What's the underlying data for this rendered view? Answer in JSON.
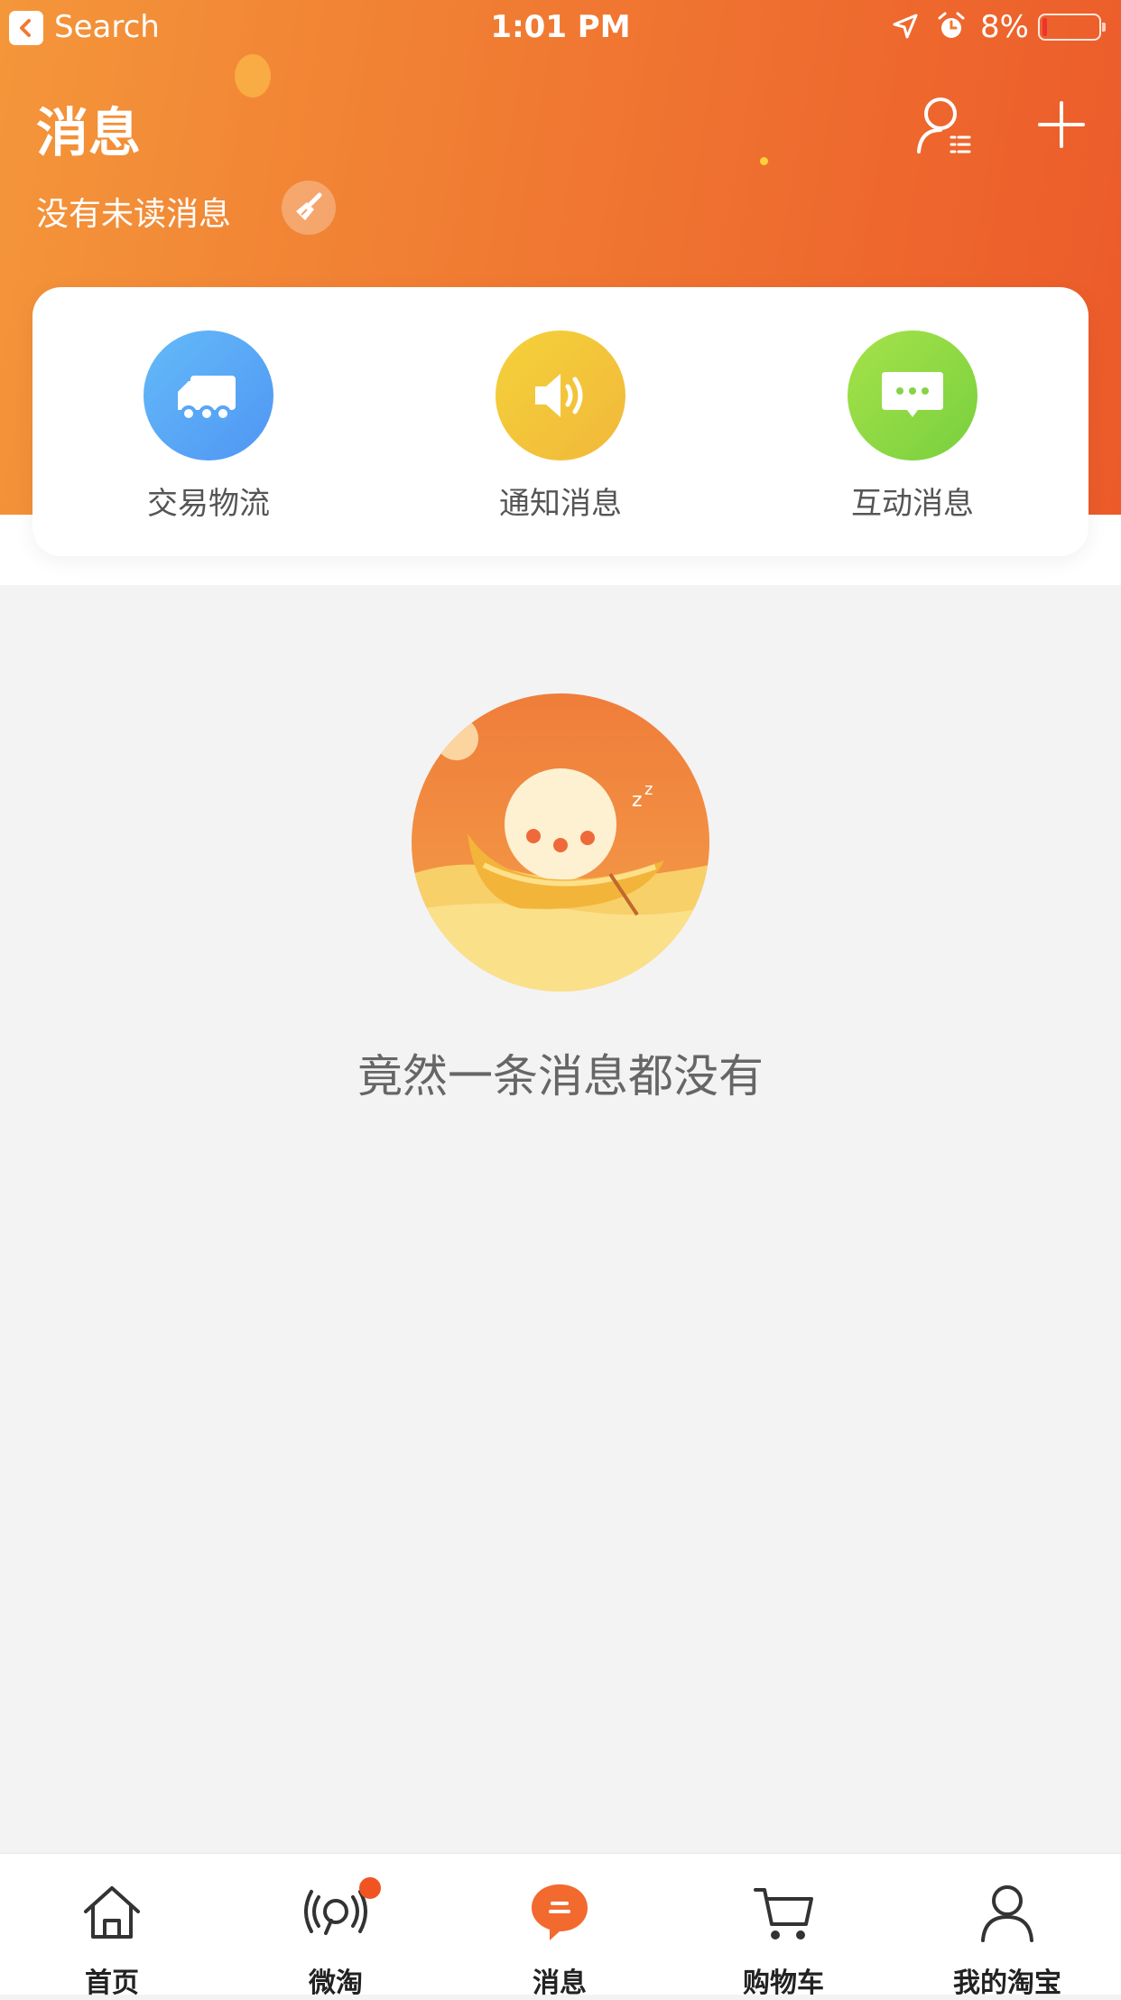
{
  "status_bar": {
    "back_label": "Search",
    "time": "1:01 PM",
    "battery": "8%"
  },
  "header": {
    "title": "消息",
    "subtitle": "没有未读消息"
  },
  "categories": [
    {
      "label": "交易物流",
      "icon": "truck-icon",
      "color": "#5aa8f8"
    },
    {
      "label": "通知消息",
      "icon": "speaker-icon",
      "color": "#f2c537"
    },
    {
      "label": "互动消息",
      "icon": "chat-dots-icon",
      "color": "#8ed84a"
    }
  ],
  "empty_state": {
    "message": "竟然一条消息都没有"
  },
  "tab_bar": {
    "items": [
      {
        "label": "首页",
        "icon": "home-icon"
      },
      {
        "label": "微淘",
        "icon": "broadcast-icon",
        "badge": true
      },
      {
        "label": "消息",
        "icon": "message-icon",
        "active": true
      },
      {
        "label": "购物车",
        "icon": "cart-icon"
      },
      {
        "label": "我的淘宝",
        "icon": "person-icon"
      }
    ]
  },
  "colors": {
    "brand": "#f07a32",
    "badge": "#f05423",
    "background": "#f3f3f3"
  }
}
